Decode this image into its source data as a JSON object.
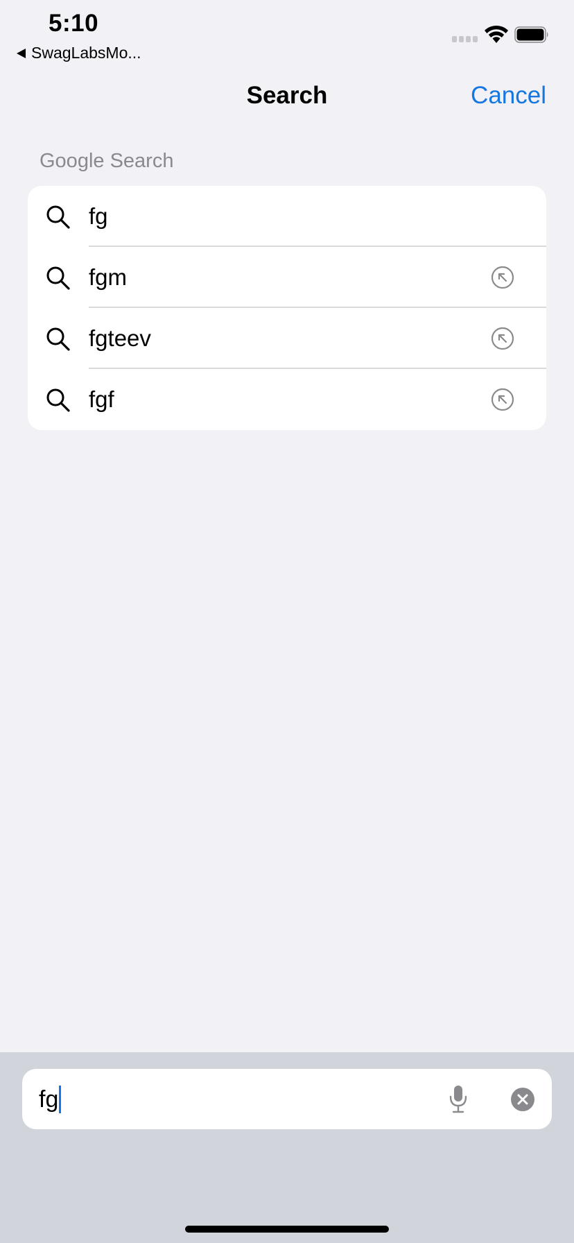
{
  "status_bar": {
    "time": "5:10",
    "back_app": "SwagLabsMo..."
  },
  "nav": {
    "title": "Search",
    "cancel_label": "Cancel"
  },
  "section_header": "Google Search",
  "suggestions": [
    {
      "label": "fg"
    },
    {
      "label": "fgm"
    },
    {
      "label": "fgteev"
    },
    {
      "label": "fgf"
    }
  ],
  "search_field": {
    "value": "fg"
  },
  "colors": {
    "accent": "#1677e0",
    "background": "#f1f1f6",
    "keyboard_bg": "#d2d4db"
  }
}
